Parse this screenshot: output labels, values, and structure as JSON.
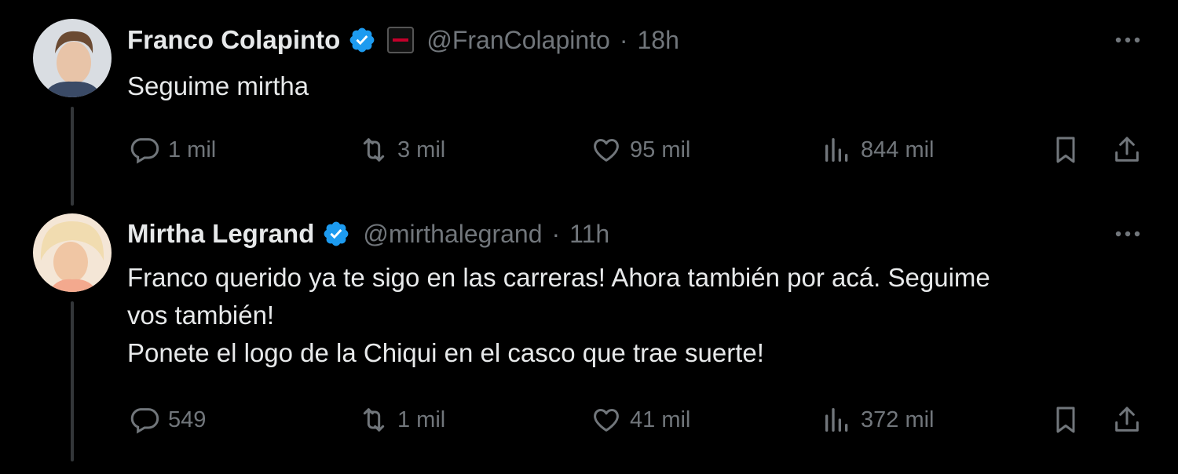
{
  "tweets": [
    {
      "name": "Franco Colapinto",
      "handle": "@FranColapinto",
      "separator": "·",
      "time": "18h",
      "text_lines": [
        "Seguime mirtha"
      ],
      "replies": "1 mil",
      "retweets": "3 mil",
      "likes": "95 mil",
      "views": "844 mil"
    },
    {
      "name": "Mirtha Legrand",
      "handle": "@mirthalegrand",
      "separator": "·",
      "time": "11h",
      "text_lines": [
        "Franco querido ya te sigo en las carreras! Ahora también por acá. Seguime",
        "vos también!",
        "Ponete el logo de la Chiqui en el casco que trae suerte!"
      ],
      "replies": "549",
      "retweets": "1 mil",
      "likes": "41 mil",
      "views": "372 mil"
    }
  ],
  "colors": {
    "background": "#000000",
    "primary_text": "#e7e9ea",
    "secondary_text": "#71767b",
    "verified_blue": "#1d9bf0"
  },
  "icons": [
    "verified-badge-icon",
    "affiliate-badge-icon",
    "more-icon",
    "reply-icon",
    "retweet-icon",
    "like-icon",
    "views-icon",
    "bookmark-icon",
    "share-icon"
  ]
}
